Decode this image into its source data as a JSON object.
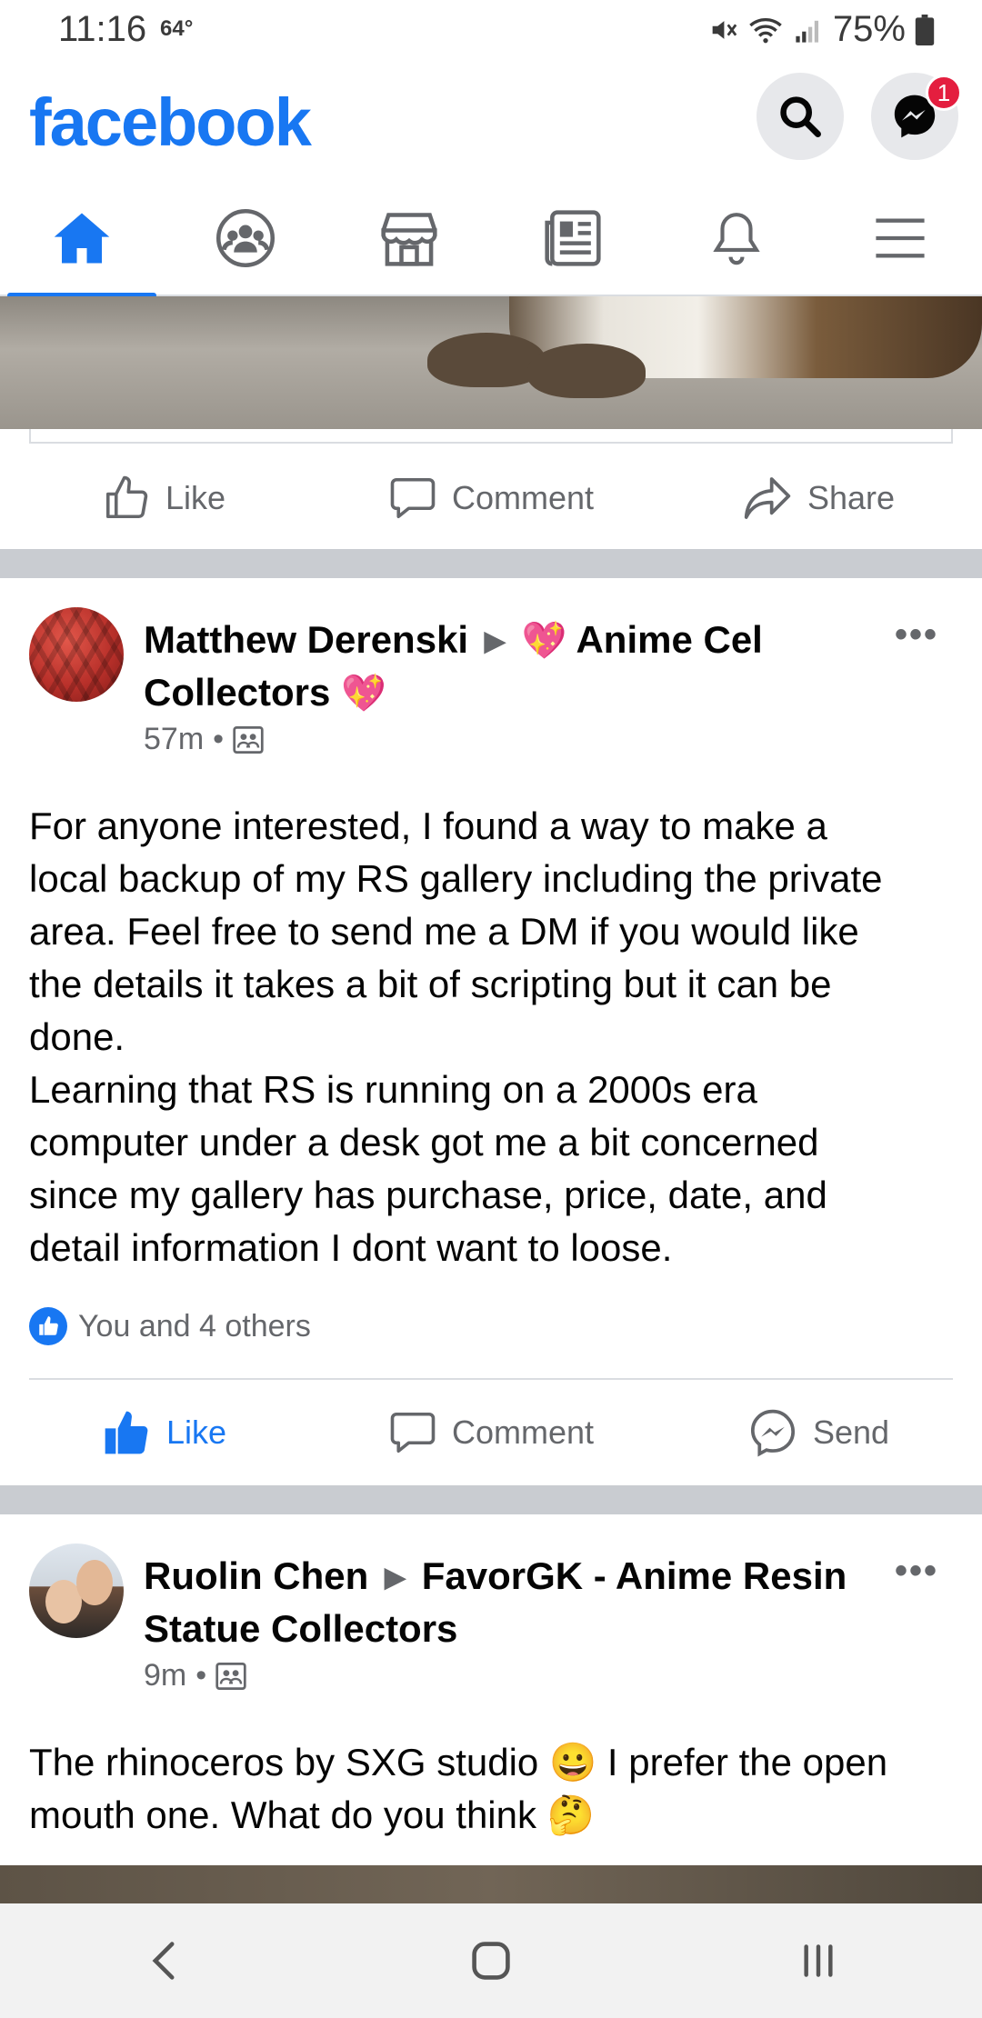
{
  "status_bar": {
    "time": "11:16",
    "temp": "64°",
    "battery": "75%"
  },
  "header": {
    "logo": "facebook",
    "messenger_badge": "1",
    "brand_color": "#1877f2"
  },
  "tabs": [
    {
      "name": "home",
      "active": true
    },
    {
      "name": "groups",
      "active": false
    },
    {
      "name": "marketplace",
      "active": false
    },
    {
      "name": "news",
      "active": false
    },
    {
      "name": "notifications",
      "active": false
    },
    {
      "name": "menu",
      "active": false
    }
  ],
  "top_post_actions": {
    "like": "Like",
    "comment": "Comment",
    "share": "Share"
  },
  "posts": [
    {
      "author": "Matthew Derenski",
      "group": "Anime Cel Collectors",
      "group_emoji": "💖",
      "time": "57m",
      "body": [
        "For anyone interested, I found a way to make a",
        "local backup of my RS gallery including the private",
        "area. Feel free to send me a DM if you would like",
        "the details it takes a bit of scripting but it can be",
        "done.",
        "Learning that RS is running on a 2000s era",
        "computer under a desk got me a bit concerned",
        "since my gallery has purchase, price, date, and",
        "detail information I dont want to loose."
      ],
      "reactions": "You and 4 others",
      "actions": {
        "like": "Like",
        "comment": "Comment",
        "send": "Send"
      }
    },
    {
      "author": "Ruolin Chen",
      "group": "FavorGK - Anime Resin Statue Collectors",
      "time": "9m",
      "body": [
        "The rhinoceros by SXG studio 😀 I prefer the open",
        "mouth one. What do you think 🤔"
      ]
    }
  ]
}
